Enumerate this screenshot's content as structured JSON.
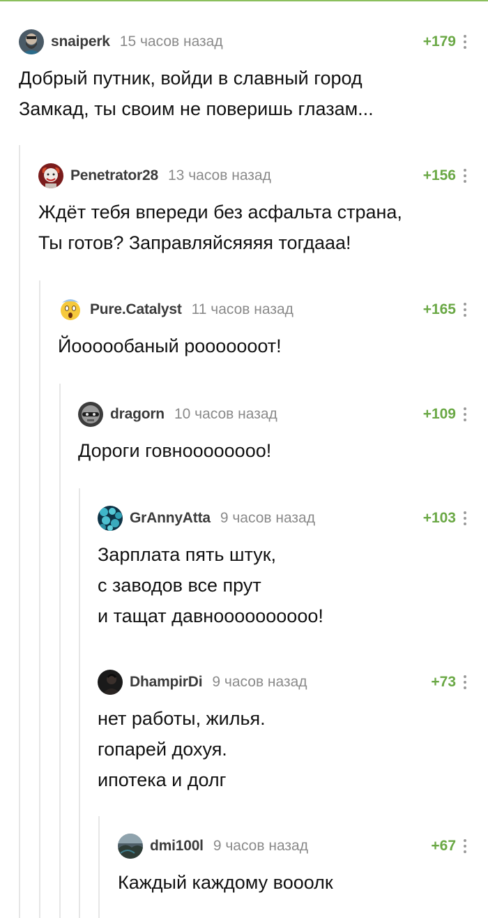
{
  "comments": [
    {
      "username": "snaiperk",
      "time": "15 часов назад",
      "rating": "+179",
      "avatar_icon": "bearded-man-avatar",
      "lines": [
        "Добрый путник, войди в славный город",
        "Замкад, ты своим не поверишь глазам..."
      ]
    },
    {
      "username": "Penetrator28",
      "time": "13 часов назад",
      "rating": "+156",
      "avatar_icon": "clown-avatar",
      "lines": [
        "Ждёт тебя впереди без асфальта страна,",
        "Ты готов? Заправляйсяяяя тогдааа!"
      ]
    },
    {
      "username": "Pure.Catalyst",
      "time": "11 часов назад",
      "rating": "+165",
      "avatar_icon": "screaming-emoji-avatar",
      "lines": [
        "Йоооообаный рооооооот!"
      ]
    },
    {
      "username": "dragorn",
      "time": "10 часов назад",
      "rating": "+109",
      "avatar_icon": "robot-avatar",
      "lines": [
        "Дороги говноооооооо!"
      ]
    },
    {
      "username": "GrAnnyAtta",
      "time": "9 часов назад",
      "rating": "+103",
      "avatar_icon": "blue-spheres-avatar",
      "lines": [
        "Зарплата пять штук,",
        "с заводов все прут",
        "и тащат давноооооооооо!"
      ]
    },
    {
      "username": "DhampirDi",
      "time": "9 часов назад",
      "rating": "+73",
      "avatar_icon": "dark-portrait-avatar",
      "lines": [
        "нет работы, жилья.",
        "гопарей дохуя.",
        "ипотека и долг"
      ]
    },
    {
      "username": "dmi100l",
      "time": "9 часов назад",
      "rating": "+67",
      "avatar_icon": "landscape-avatar",
      "lines": [
        "Каждый каждому вооолк"
      ]
    }
  ],
  "colors": {
    "rating": "#6aa845",
    "accent_line": "#8bbf5c",
    "thread_line": "#e6e6e6"
  }
}
